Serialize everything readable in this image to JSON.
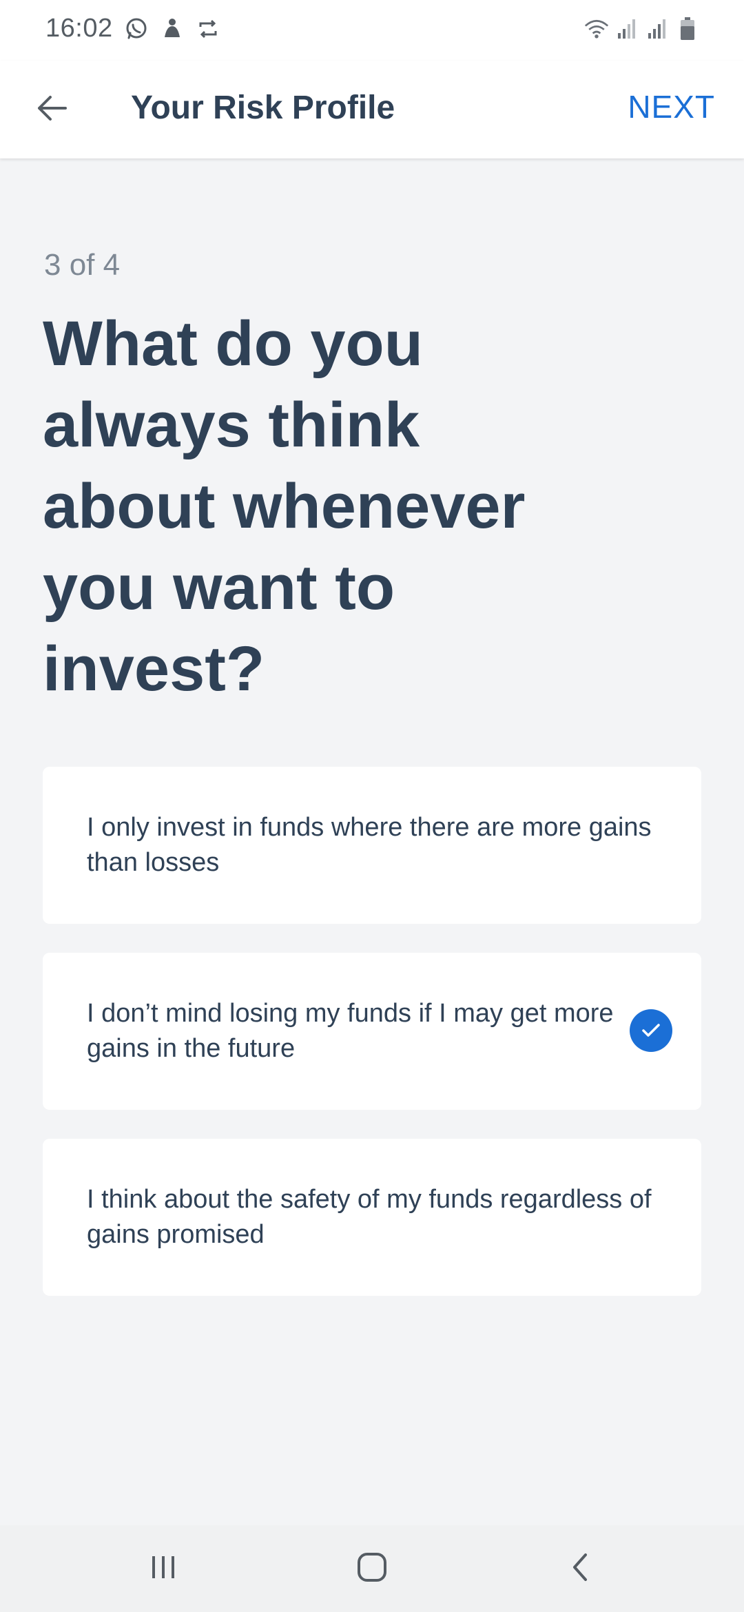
{
  "status_bar": {
    "time": "16:02",
    "left_icons": [
      "whatsapp-icon",
      "notification-app-icon",
      "sync-icon"
    ],
    "right_icons": [
      "wifi-icon",
      "signal-icon",
      "signal-icon",
      "battery-icon"
    ]
  },
  "app_bar": {
    "back_icon": "arrow-left-icon",
    "title": "Your Risk Profile",
    "next_label": "NEXT",
    "accent_color": "#1b6fd6"
  },
  "question": {
    "step": "3 of 4",
    "text": "What do you always think about whenever you want to invest?"
  },
  "options": [
    {
      "text": "I only invest in funds where there are more gains than losses",
      "selected": false
    },
    {
      "text": "I don’t mind losing my funds if I may get more gains in the future",
      "selected": true
    },
    {
      "text": "I think about the safety of my funds regardless of gains promised",
      "selected": false
    }
  ],
  "nav_bar": {
    "buttons": [
      "recent-apps-icon",
      "home-icon",
      "back-icon"
    ]
  }
}
